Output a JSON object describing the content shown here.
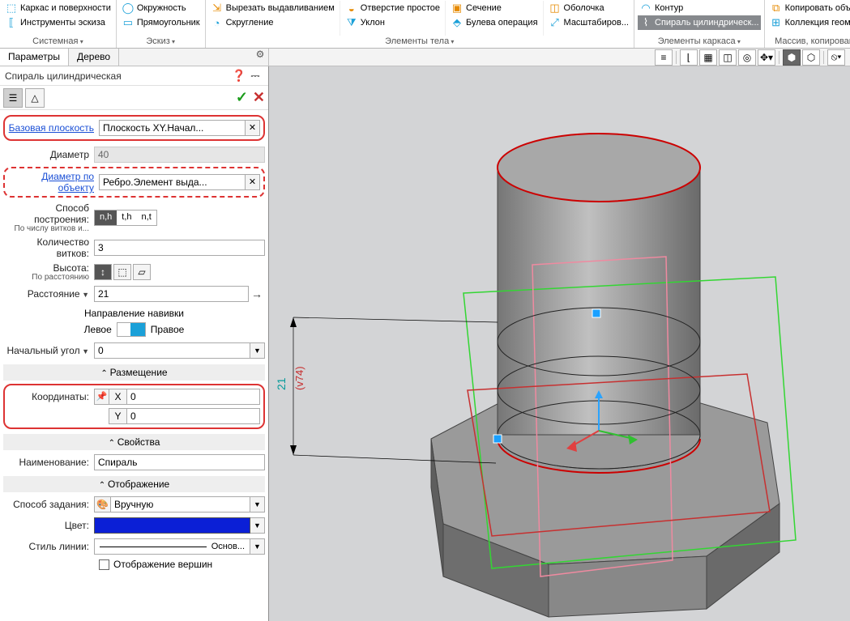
{
  "ribbon": {
    "groups": [
      {
        "title": "Системная",
        "items": [
          [
            "Каркас и поверхности",
            "⬚"
          ],
          [
            "Инструменты эскиза",
            "⟦"
          ]
        ]
      },
      {
        "title": "Эскиз",
        "items": [
          [
            "Окружность",
            "◯"
          ],
          [
            "Прямоугольник",
            "▭"
          ]
        ]
      },
      {
        "title": "Элементы тела",
        "cols": [
          [
            [
              "Вырезать выдавливанием",
              "⇲"
            ],
            [
              "Скругление",
              "◔"
            ]
          ],
          [
            [
              "Отверстие простое",
              "◒"
            ],
            [
              "Уклон",
              "⧩"
            ]
          ],
          [
            [
              "Сечение",
              "▣"
            ],
            [
              "Булева операция",
              "⬘"
            ]
          ],
          [
            [
              "Оболочка",
              "◫"
            ],
            [
              "Масштабиров...",
              "⤢"
            ]
          ]
        ]
      },
      {
        "title": "Элементы каркаса",
        "items": [
          [
            "Контур",
            "◠"
          ],
          [
            "Спираль цилиндрическ...",
            "⌇"
          ]
        ]
      },
      {
        "title": "Массив, копирование",
        "items": [
          [
            "Копировать объекты",
            "⧉"
          ],
          [
            "Коллекция геометрии",
            "⊞"
          ]
        ]
      }
    ]
  },
  "tabs": {
    "params": "Параметры",
    "tree": "Дерево"
  },
  "panel": {
    "title": "Спираль цилиндрическая",
    "base_plane_label": "Базовая плоскость",
    "base_plane_value": "Плоскость XY.Начал...",
    "diameter_label": "Диаметр",
    "diameter_value": "40",
    "diam_by_obj_label": "Диаметр по объекту",
    "diam_by_obj_value": "Ребро.Элемент выда...",
    "build_method_label": "Способ построения:",
    "build_method_sub": "По числу витков и...",
    "mode_nh": "n,h",
    "mode_th": "t,h",
    "mode_nt": "n,t",
    "turns_label": "Количество витков:",
    "turns_value": "3",
    "height_label": "Высота:",
    "height_sub": "По расстоянию",
    "distance_label": "Расстояние",
    "distance_value": "21",
    "winding_label": "Направление навивки",
    "left": "Левое",
    "right": "Правое",
    "start_angle_label": "Начальный угол",
    "start_angle_value": "0",
    "sec_placement": "Размещение",
    "coords_label": "Координаты:",
    "x_label": "X",
    "y_label": "Y",
    "x_value": "0",
    "y_value": "0",
    "sec_props": "Свойства",
    "name_label": "Наименование:",
    "name_value": "Спираль",
    "sec_display": "Отображение",
    "disp_method_label": "Способ задания:",
    "disp_method_value": "Вручную",
    "color_label": "Цвет:",
    "line_style_label": "Стиль линии:",
    "line_style_value": "Основ...",
    "show_verts": "Отображение вершин"
  },
  "viewport_annotations": {
    "dim_value": "21",
    "dim_hint": "(v74)"
  }
}
